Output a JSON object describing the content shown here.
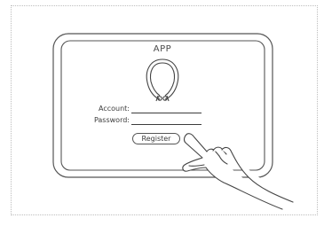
{
  "app": {
    "title": "APP",
    "logo_icon": "neckband-headphones-icon"
  },
  "form": {
    "account_label": "Account:",
    "password_label": "Password:",
    "account_value": "",
    "password_value": ""
  },
  "actions": {
    "register_label": "Register"
  },
  "illustration": {
    "pointer": "pointing-hand-icon",
    "line_color": "#4a4a4a"
  }
}
